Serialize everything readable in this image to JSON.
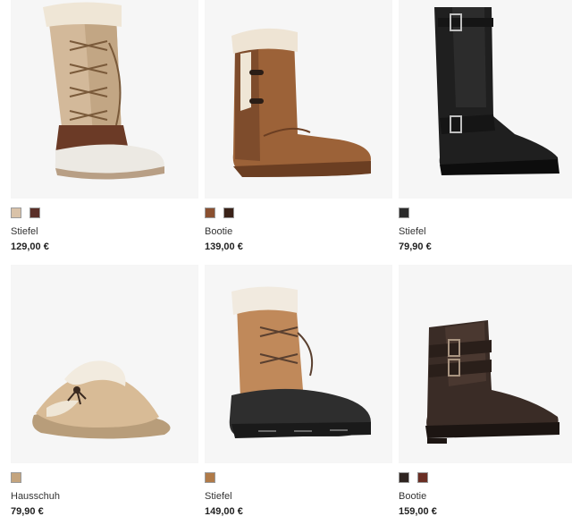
{
  "products": [
    {
      "name": "Stiefel",
      "price": "129,00 €",
      "image_icon": "winter-lace-up-boot-icon",
      "swatches": [
        "#d9c2a8",
        "#5a2f28"
      ]
    },
    {
      "name": "Bootie",
      "price": "139,00 €",
      "image_icon": "sheepskin-bootie-icon",
      "swatches": [
        "#8a5030",
        "#3a2218"
      ]
    },
    {
      "name": "Stiefel",
      "price": "79,90 €",
      "image_icon": "black-riding-boot-icon",
      "swatches": [
        "#2b2b2b"
      ]
    },
    {
      "name": "Hausschuh",
      "price": "79,90 €",
      "image_icon": "sheepskin-slipper-icon",
      "swatches": [
        "#c4a47e"
      ]
    },
    {
      "name": "Stiefel",
      "price": "149,00 €",
      "image_icon": "duck-boot-icon",
      "swatches": [
        "#b07a48"
      ]
    },
    {
      "name": "Bootie",
      "price": "159,00 €",
      "image_icon": "buckle-ankle-boot-icon",
      "swatches": [
        "#2e2420",
        "#6a2e24"
      ]
    }
  ]
}
